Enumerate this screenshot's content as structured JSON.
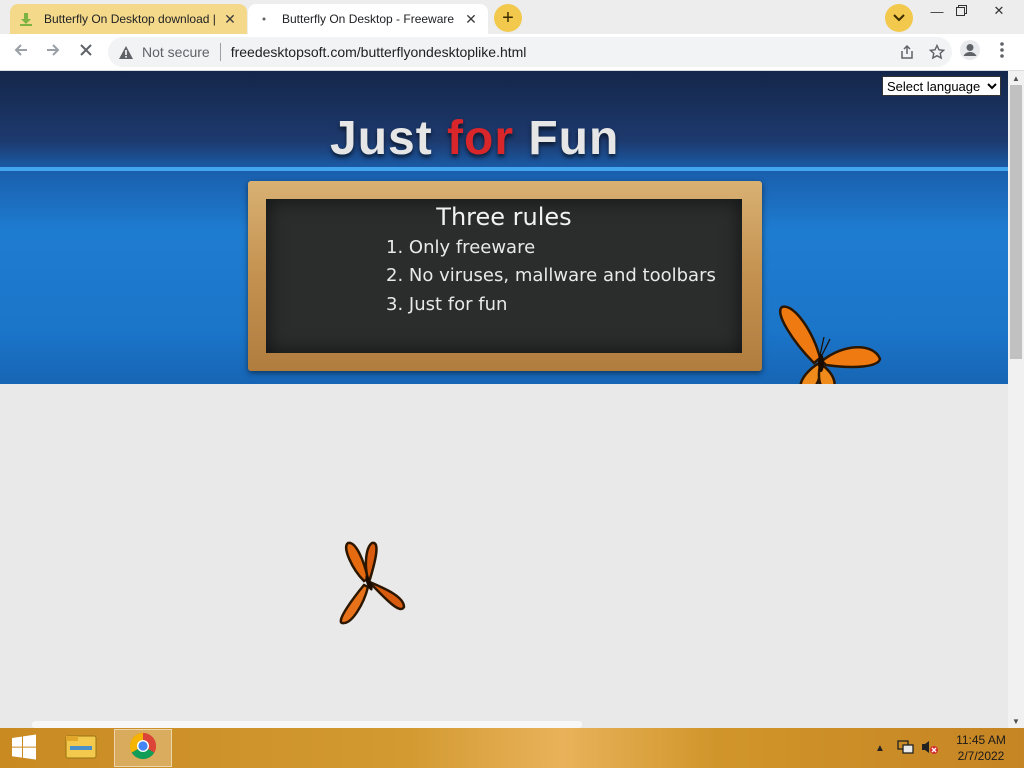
{
  "browser": {
    "tabs": [
      {
        "title": "Butterfly On Desktop download |",
        "active": false,
        "favicon": "download-arrow-icon"
      },
      {
        "title": "Butterfly On Desktop - Freeware",
        "active": true,
        "favicon": "loading-dot-icon"
      }
    ],
    "address": {
      "security_label": "Not secure",
      "url": "freedesktopsoft.com/butterflyondesktoplike.html"
    },
    "language_select": {
      "selected": "Select language"
    }
  },
  "page": {
    "header_title_part1": "Just ",
    "header_title_part2": "for",
    "header_title_part3": " Fun",
    "board_title": "Three rules",
    "rules": [
      "1. Only freeware",
      "2. No viruses, mallware and toolbars",
      "3. Just for fun"
    ]
  },
  "taskbar": {
    "time": "11:45 AM",
    "date": "2/7/2022"
  },
  "colors": {
    "accent_tab": "#f4d98b",
    "header_dark": "#14264a",
    "header_blue": "#1e7cd0",
    "title_red": "#d8262b",
    "taskbar": "#c98a22"
  }
}
